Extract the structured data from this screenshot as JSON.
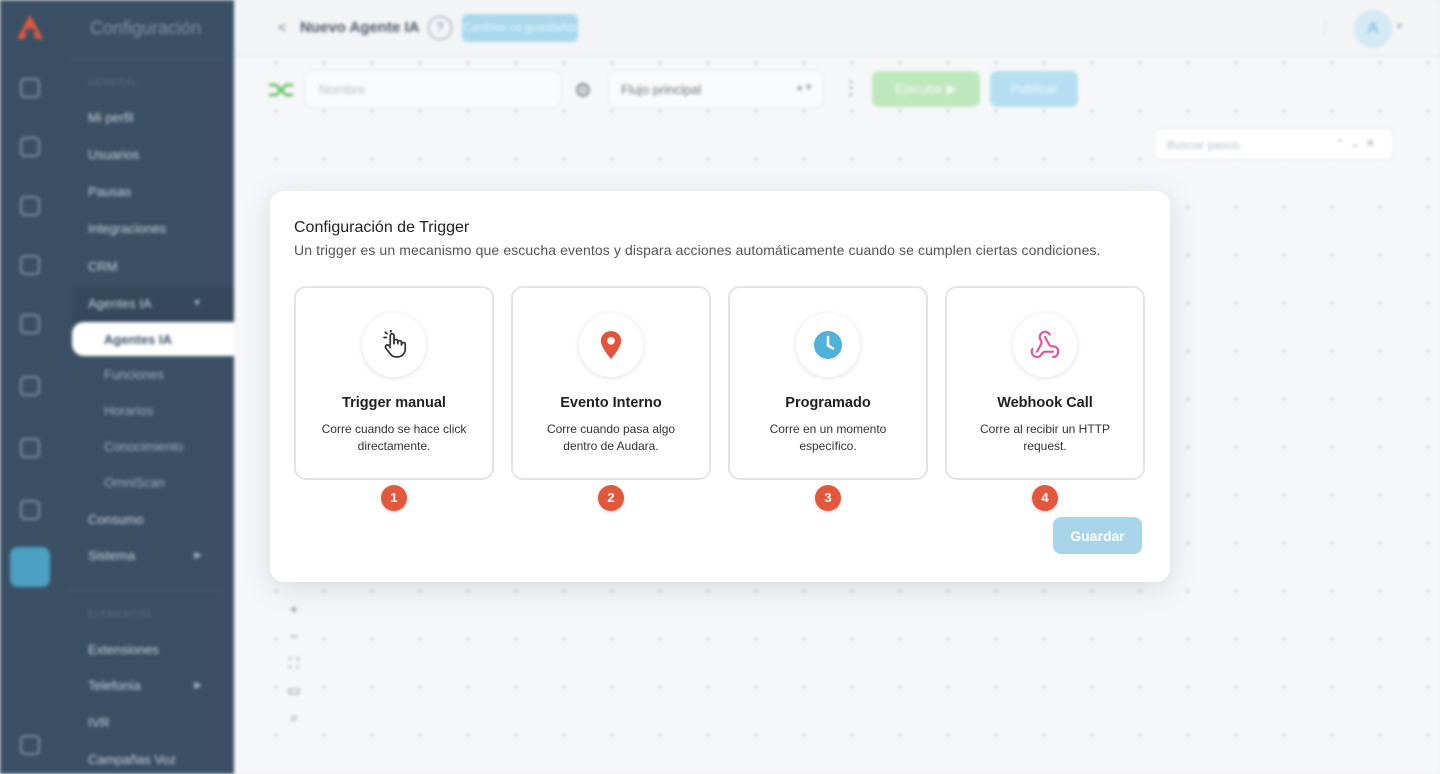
{
  "sidebar": {
    "title": "Configuración",
    "section_general": "GENERAL",
    "section_elementos": "ELEMENTOS",
    "items": [
      "Mi perfil",
      "Usuarios",
      "Pausas",
      "Integraciones",
      "CRM",
      "Agentes IA"
    ],
    "agentes_sub": [
      "Agentes IA",
      "Funciones",
      "Horarios",
      "Conocimiento",
      "OmniScan"
    ],
    "items2": [
      "Consumo",
      "Sistema"
    ],
    "elementos": [
      "Extensiones",
      "Telefonía",
      "IVR",
      "Campañas Voz"
    ]
  },
  "header": {
    "title": "Nuevo Agente IA",
    "help": "?",
    "unsaved_label": "Cambios no guardados",
    "avatar": "A"
  },
  "toolbar": {
    "name_placeholder": "Nombre",
    "flow_select": "Flujo principal",
    "run_label": "Ejecutar ▶",
    "publish_label": "Publicar",
    "search_placeholder": "Buscar pasos"
  },
  "modal": {
    "title": "Configuración de Trigger",
    "description": "Un trigger es un mecanismo que escucha eventos y dispara acciones automáticamente cuando se cumplen ciertas condiciones.",
    "cards": [
      {
        "title": "Trigger manual",
        "desc": "Corre cuando se hace click directamente.",
        "badge": "1",
        "icon": "pointer-hand-icon"
      },
      {
        "title": "Evento Interno",
        "desc": "Corre cuando pasa algo dentro de Audara.",
        "badge": "2",
        "icon": "map-pin-icon"
      },
      {
        "title": "Programado",
        "desc": "Corre en un momento específico.",
        "badge": "3",
        "icon": "clock-icon"
      },
      {
        "title": "Webhook Call",
        "desc": "Corre al recibir un HTTP request.",
        "badge": "4",
        "icon": "webhook-icon"
      }
    ],
    "save_label": "Guardar"
  },
  "colors": {
    "sidebar": "#3b5064",
    "badge": "#e2583d",
    "pin": "#e5533d",
    "clock": "#4fb3d9",
    "webhook": "#e0559a",
    "save_button": "#a8d5ea"
  }
}
